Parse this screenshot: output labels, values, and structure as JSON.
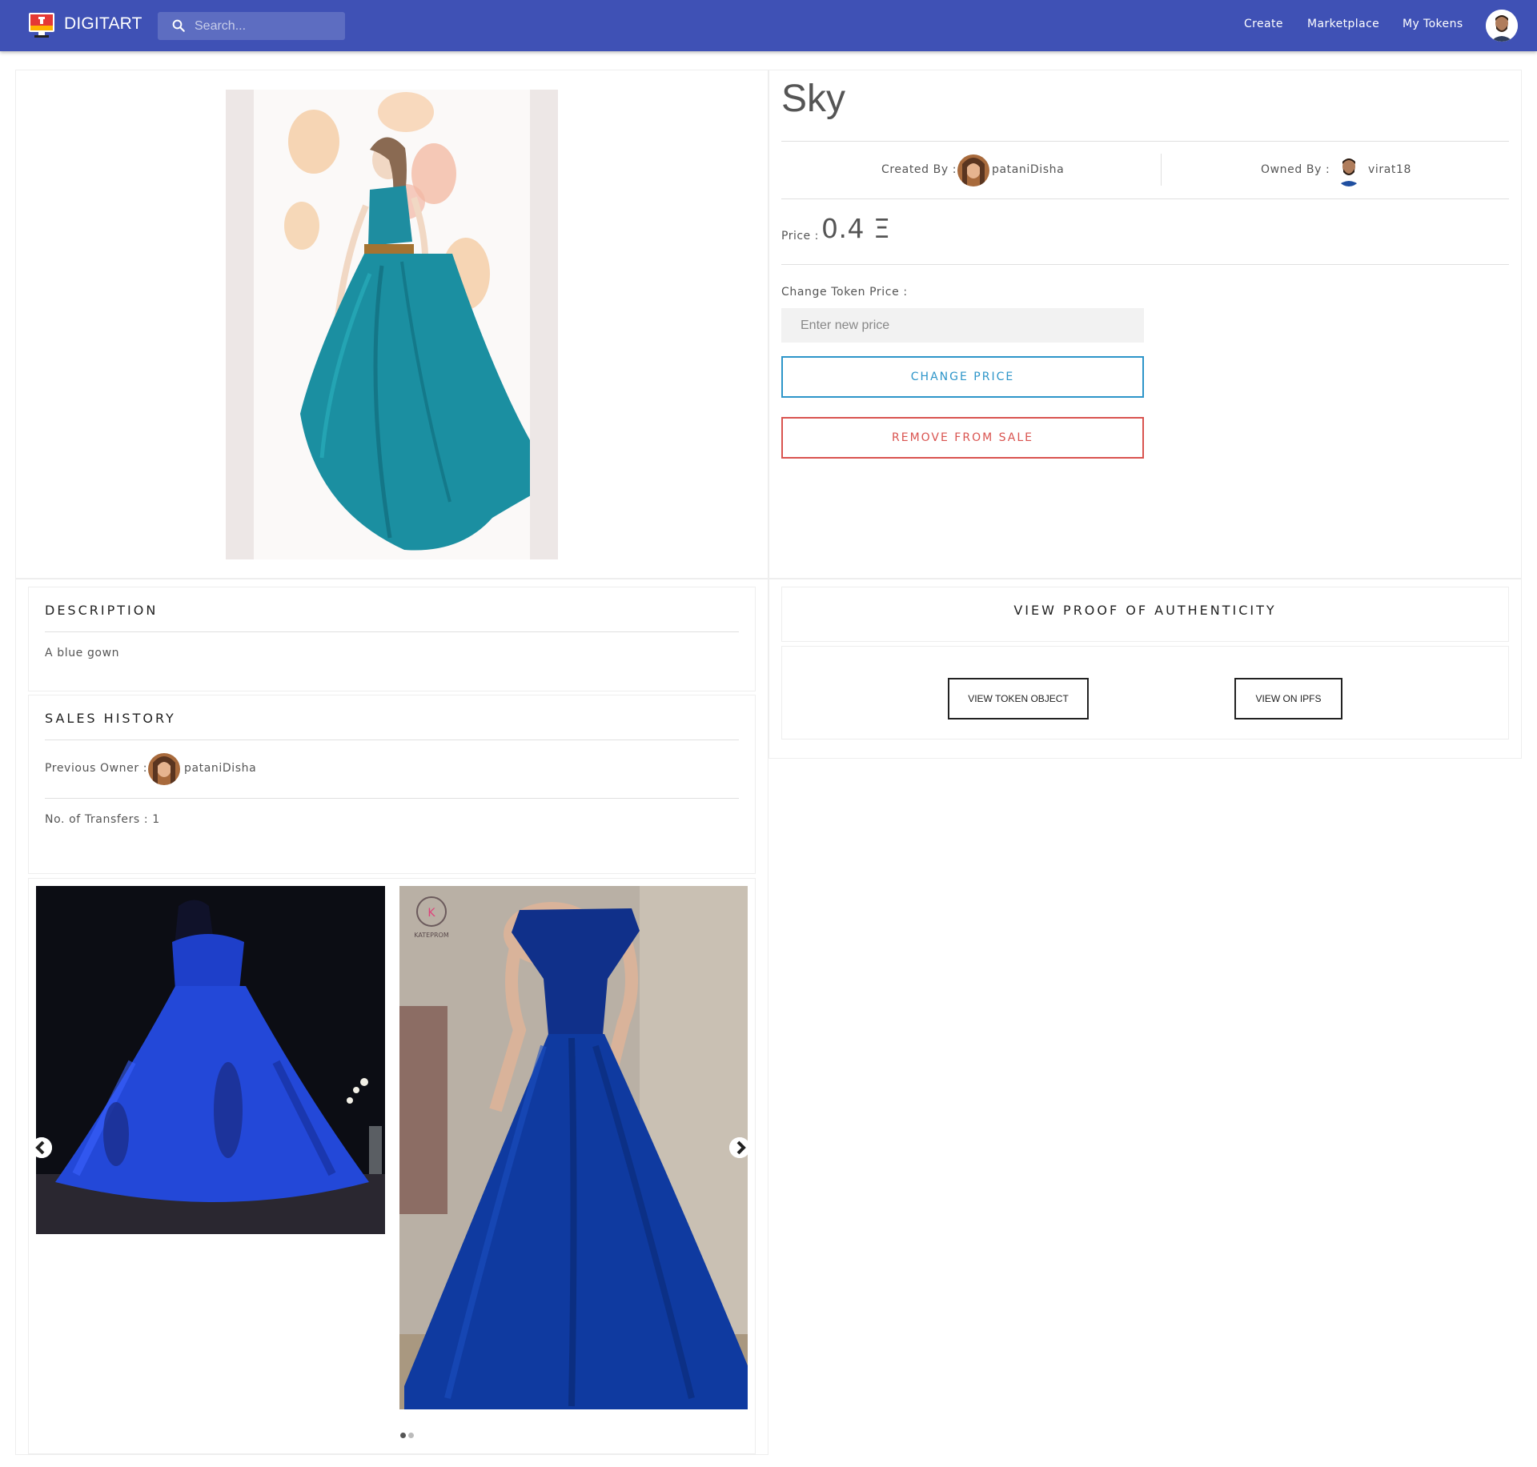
{
  "header": {
    "brand": "DIGITART",
    "search_placeholder": "Search...",
    "nav": {
      "create": "Create",
      "marketplace": "Marketplace",
      "my_tokens": "My Tokens"
    },
    "colors": {
      "bar": "#3f51b5"
    }
  },
  "token": {
    "title": "Sky",
    "created_by_label": "Created By :",
    "creator": "pataniDisha",
    "owned_by_label": "Owned By :",
    "owner": "virat18",
    "price_label": "Price :",
    "price_value": "0.4 Ξ",
    "change_price_label": "Change Token Price :",
    "new_price_placeholder": "Enter new price",
    "change_price_button": "CHANGE PRICE",
    "remove_button": "REMOVE FROM SALE"
  },
  "description": {
    "heading": "DESCRIPTION",
    "text": "A blue gown"
  },
  "sales_history": {
    "heading": "SALES HISTORY",
    "previous_owner_label": "Previous Owner :",
    "previous_owner": "pataniDisha",
    "transfers": "No. of Transfers : 1"
  },
  "proof": {
    "heading": "VIEW PROOF OF AUTHENTICITY",
    "view_token_object": "VIEW TOKEN OBJECT",
    "view_on_ipfs": "VIEW ON IPFS"
  },
  "carousel": {
    "watermark": "KATEPROM",
    "page": 1,
    "pages": 2
  },
  "colors": {
    "accent_blue": "#2d95c9",
    "danger_red": "#d9534f",
    "text": "#555555"
  }
}
